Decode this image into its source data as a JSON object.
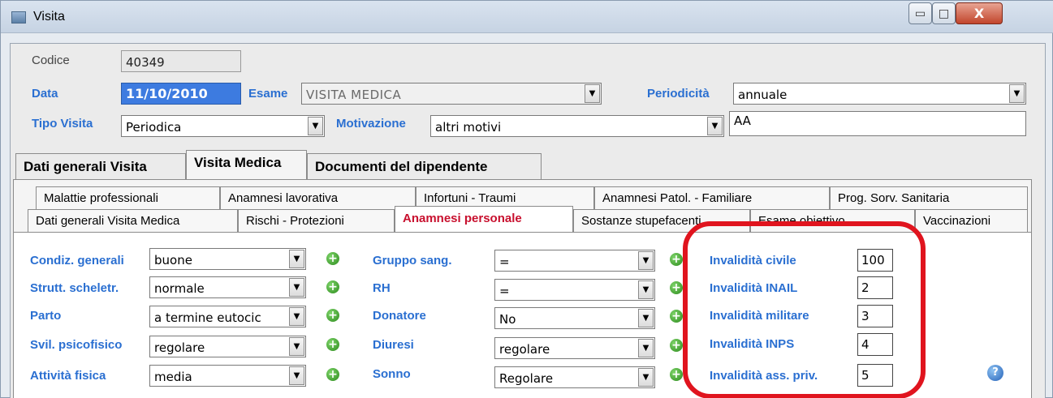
{
  "window": {
    "title": "Visita",
    "buttons": {
      "minimize": "▭",
      "maximize": "□",
      "close": "X"
    }
  },
  "header": {
    "codice_label": "Codice",
    "codice_value": "40349",
    "data_label": "Data",
    "data_value": "11/10/2010",
    "esame_label": "Esame",
    "esame_value": "VISITA MEDICA",
    "periodicita_label": "Periodicità",
    "periodicita_value": "annuale",
    "tipo_visita_label": "Tipo Visita",
    "tipo_visita_value": "Periodica",
    "motivazione_label": "Motivazione",
    "motivazione_value": "altri motivi",
    "note_value": "AA"
  },
  "main_tabs": [
    {
      "label": "Dati generali Visita",
      "active": false
    },
    {
      "label": "Visita Medica",
      "active": true
    },
    {
      "label": "Documenti del dipendente",
      "active": false
    }
  ],
  "sub_tabs_row1": [
    {
      "label": "Malattie professionali"
    },
    {
      "label": "Anamnesi lavorativa"
    },
    {
      "label": "Infortuni - Traumi"
    },
    {
      "label": "Anamnesi Patol. - Familiare"
    },
    {
      "label": "Prog. Sorv. Sanitaria"
    }
  ],
  "sub_tabs_row2": [
    {
      "label": "Dati generali Visita Medica",
      "active": false
    },
    {
      "label": "Rischi - Protezioni",
      "active": false
    },
    {
      "label": "Anamnesi personale",
      "active": true
    },
    {
      "label": "Sostanze stupefacenti",
      "active": false
    },
    {
      "label": "Esame obiettivo",
      "active": false
    },
    {
      "label": "Vaccinazioni",
      "active": false
    }
  ],
  "anamnesi": {
    "left": [
      {
        "label": "Condiz. generali",
        "value": "buone"
      },
      {
        "label": "Strutt. scheletr.",
        "value": "normale"
      },
      {
        "label": "Parto",
        "value": "a termine eutocic"
      },
      {
        "label": "Svil. psicofisico",
        "value": "regolare"
      },
      {
        "label": "Attività fisica",
        "value": "media"
      }
    ],
    "middle": [
      {
        "label": "Gruppo sang.",
        "value": "="
      },
      {
        "label": "RH",
        "value": "="
      },
      {
        "label": "Donatore",
        "value": "No"
      },
      {
        "label": "Diuresi",
        "value": "regolare"
      },
      {
        "label": "Sonno",
        "value": "Regolare"
      }
    ],
    "invalidita": [
      {
        "label": "Invalidità civile",
        "value": "100"
      },
      {
        "label": "Invalidità INAIL",
        "value": "2"
      },
      {
        "label": "Invalidità militare",
        "value": "3"
      },
      {
        "label": "Invalidità INPS",
        "value": "4"
      },
      {
        "label": "Invalidità ass. priv.",
        "value": "5"
      }
    ]
  },
  "colors": {
    "label_blue": "#2a6fd1",
    "active_tab_red": "#c8102e",
    "highlight_red": "#e0141e",
    "date_selected": "#3d7be0"
  },
  "icons": {
    "add": "plus-circle-icon",
    "help": "help-icon",
    "dropdown": "chevron-down-icon"
  }
}
